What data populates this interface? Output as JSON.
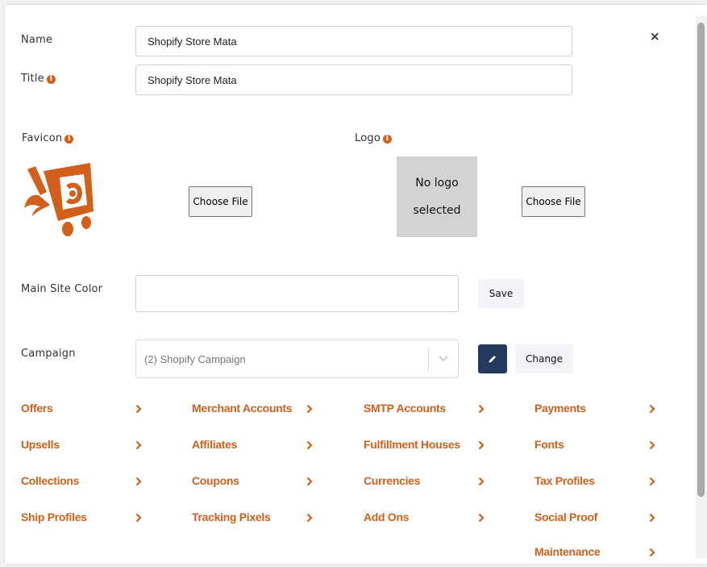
{
  "form": {
    "name_label": "Name",
    "name_value": "Shopify Store Mata",
    "title_label": "Title",
    "title_value": "Shopify Store Mata",
    "favicon_label": "Favicon",
    "logo_label": "Logo",
    "logo_placeholder_line1": "No logo",
    "logo_placeholder_line2": "selected",
    "choose_file": "Choose File",
    "main_color_label": "Main Site Color",
    "main_color_value": "",
    "save_label": "Save",
    "campaign_label": "Campaign",
    "campaign_value": "(2) Shopify Campaign",
    "change_label": "Change",
    "info_glyph": "i",
    "close_glyph": "×"
  },
  "colors": {
    "accent": "#d2601a",
    "dark_button": "#243a5e",
    "logo_placeholder": "#d3d3d3"
  },
  "links": [
    "Offers",
    "Merchant Accounts",
    "SMTP Accounts",
    "Payments",
    "Upsells",
    "Affiliates",
    "Fulfillment Houses",
    "Fonts",
    "Collections",
    "Coupons",
    "Currencies",
    "Tax Profiles",
    "Ship Profiles",
    "Tracking Pixels",
    "Add Ons",
    "Social Proof",
    "Maintenance"
  ]
}
